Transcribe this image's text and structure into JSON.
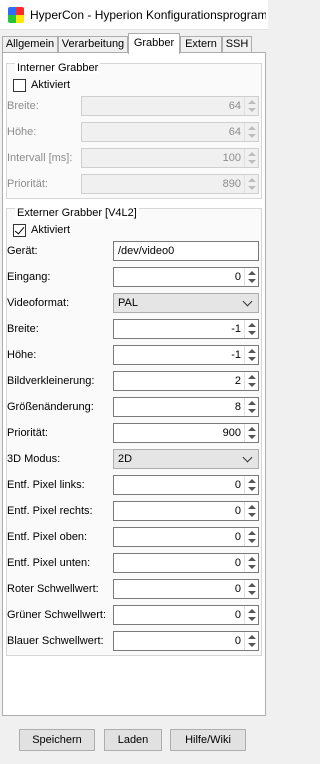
{
  "window": {
    "title": "HyperCon - Hyperion Konfigurationsprogramm"
  },
  "tabs": [
    {
      "label": "Allgemein"
    },
    {
      "label": "Verarbeitung"
    },
    {
      "label": "Grabber",
      "active": true
    },
    {
      "label": "Extern"
    },
    {
      "label": "SSH"
    }
  ],
  "internal": {
    "title": "Interner Grabber",
    "active_label": "Aktiviert",
    "active_checked": false,
    "fields": [
      {
        "label": "Breite:",
        "value": "64"
      },
      {
        "label": "Höhe:",
        "value": "64"
      },
      {
        "label": "Intervall [ms]:",
        "value": "100"
      },
      {
        "label": "Priorität:",
        "value": "890"
      }
    ]
  },
  "external": {
    "title": "Externer Grabber [V4L2]",
    "active_label": "Aktiviert",
    "active_checked": true,
    "device": {
      "label": "Gerät:",
      "value": "/dev/video0"
    },
    "input": {
      "label": "Eingang:",
      "value": "0"
    },
    "video_format": {
      "label": "Videoformat:",
      "value": "PAL"
    },
    "width": {
      "label": "Breite:",
      "value": "-1"
    },
    "height": {
      "label": "Höhe:",
      "value": "-1"
    },
    "decimation": {
      "label": "Bildverkleinerung:",
      "value": "2"
    },
    "resize": {
      "label": "Größenänderung:",
      "value": "8"
    },
    "priority": {
      "label": "Priorität:",
      "value": "900"
    },
    "mode3d": {
      "label": "3D Modus:",
      "value": "2D"
    },
    "crop_left": {
      "label": "Entf. Pixel links:",
      "value": "0"
    },
    "crop_right": {
      "label": "Entf. Pixel rechts:",
      "value": "0"
    },
    "crop_top": {
      "label": "Entf. Pixel oben:",
      "value": "0"
    },
    "crop_bottom": {
      "label": "Entf. Pixel unten:",
      "value": "0"
    },
    "red_threshold": {
      "label": "Roter Schwellwert:",
      "value": "0"
    },
    "green_threshold": {
      "label": "Grüner Schwellwert:",
      "value": "0"
    },
    "blue_threshold": {
      "label": "Blauer Schwellwert:",
      "value": "0"
    }
  },
  "buttons": {
    "save": "Speichern",
    "load": "Laden",
    "help": "Hilfe/Wiki"
  }
}
